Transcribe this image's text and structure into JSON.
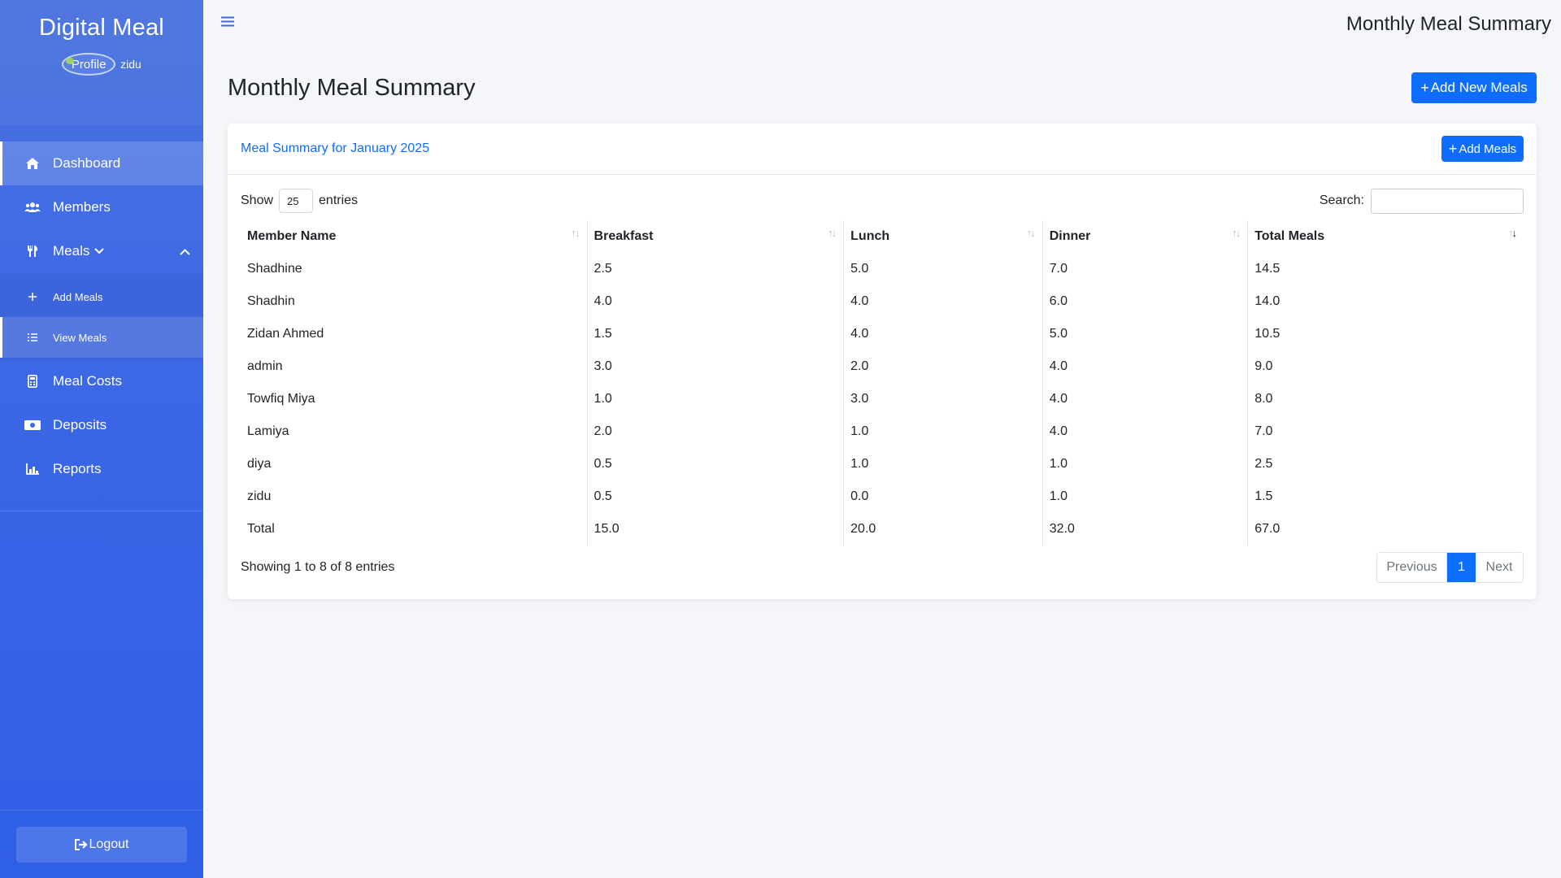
{
  "sidebar": {
    "brand": "Digital Meal",
    "profile_alt": "Profile",
    "username": "zidu",
    "items": [
      {
        "label": "Dashboard",
        "icon": "home-icon"
      },
      {
        "label": "Members",
        "icon": "users-icon"
      },
      {
        "label": "Meals",
        "icon": "utensils-icon"
      },
      {
        "label": "Meal Costs",
        "icon": "calculator-icon"
      },
      {
        "label": "Deposits",
        "icon": "money-icon"
      },
      {
        "label": "Reports",
        "icon": "chart-icon"
      }
    ],
    "submenu": [
      {
        "label": "Add Meals",
        "icon": "plus-icon"
      },
      {
        "label": "View Meals",
        "icon": "list-icon"
      }
    ],
    "logout": "Logout"
  },
  "topbar": {
    "title": "Monthly Meal Summary"
  },
  "main": {
    "title": "Monthly Meal Summary",
    "add_new_label": "Add New Meals",
    "card": {
      "title": "Meal Summary for January 2025",
      "add_label": "Add Meals"
    },
    "datatable": {
      "show_label": "Show",
      "entries_value": "25",
      "entries_label": "entries",
      "search_label": "Search:",
      "search_value": "",
      "columns": [
        "Member Name",
        "Breakfast",
        "Lunch",
        "Dinner",
        "Total Meals"
      ],
      "rows": [
        [
          "Shadhine",
          "2.5",
          "5.0",
          "7.0",
          "14.5"
        ],
        [
          "Shadhin",
          "4.0",
          "4.0",
          "6.0",
          "14.0"
        ],
        [
          "Zidan Ahmed",
          "1.5",
          "4.0",
          "5.0",
          "10.5"
        ],
        [
          "admin",
          "3.0",
          "2.0",
          "4.0",
          "9.0"
        ],
        [
          "Towfiq Miya",
          "1.0",
          "3.0",
          "4.0",
          "8.0"
        ],
        [
          "Lamiya",
          "2.0",
          "1.0",
          "4.0",
          "7.0"
        ],
        [
          "diya",
          "0.5",
          "1.0",
          "1.0",
          "2.5"
        ],
        [
          "zidu",
          "0.5",
          "0.0",
          "1.0",
          "1.5"
        ]
      ],
      "total_row": [
        "Total",
        "15.0",
        "20.0",
        "32.0",
        "67.0"
      ],
      "info": "Showing 1 to 8 of 8 entries",
      "pagination": {
        "previous": "Previous",
        "current": "1",
        "next": "Next"
      }
    }
  },
  "colors": {
    "sidebar": "#3a66e6",
    "accent": "#0d6efd",
    "background": "#f5f6fa"
  }
}
